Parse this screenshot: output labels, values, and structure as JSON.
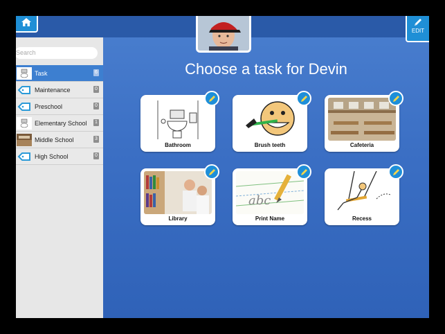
{
  "header": {
    "edit_label": "EDIT"
  },
  "search": {
    "placeholder": "Search"
  },
  "sidebar": {
    "items": [
      {
        "label": "Task",
        "count": "6",
        "active": true,
        "icon": "bathroom-icon"
      },
      {
        "label": "Maintenance",
        "count": "0",
        "active": false,
        "icon": "tag-icon"
      },
      {
        "label": "Preschool",
        "count": "0",
        "active": false,
        "icon": "tag-icon"
      },
      {
        "label": "Elementary School",
        "count": "1",
        "active": false,
        "icon": "bathroom-icon"
      },
      {
        "label": "Middle School",
        "count": "3",
        "active": false,
        "icon": "cafeteria-icon"
      },
      {
        "label": "High School",
        "count": "0",
        "active": false,
        "icon": "tag-icon"
      }
    ]
  },
  "main": {
    "title": "Choose a task for Devin",
    "tasks": [
      {
        "label": "Bathroom",
        "icon": "bathroom-icon"
      },
      {
        "label": "Brush teeth",
        "icon": "brush-teeth-icon"
      },
      {
        "label": "Cafeteria",
        "icon": "cafeteria-icon"
      },
      {
        "label": "Library",
        "icon": "library-icon"
      },
      {
        "label": "Print Name",
        "icon": "print-name-icon"
      },
      {
        "label": "Recess",
        "icon": "recess-icon"
      }
    ]
  },
  "colors": {
    "accent": "#1f8fd6",
    "background": "#3b6fc4",
    "sidebar": "#e7e7e7",
    "active_row": "#3d7fd0"
  }
}
